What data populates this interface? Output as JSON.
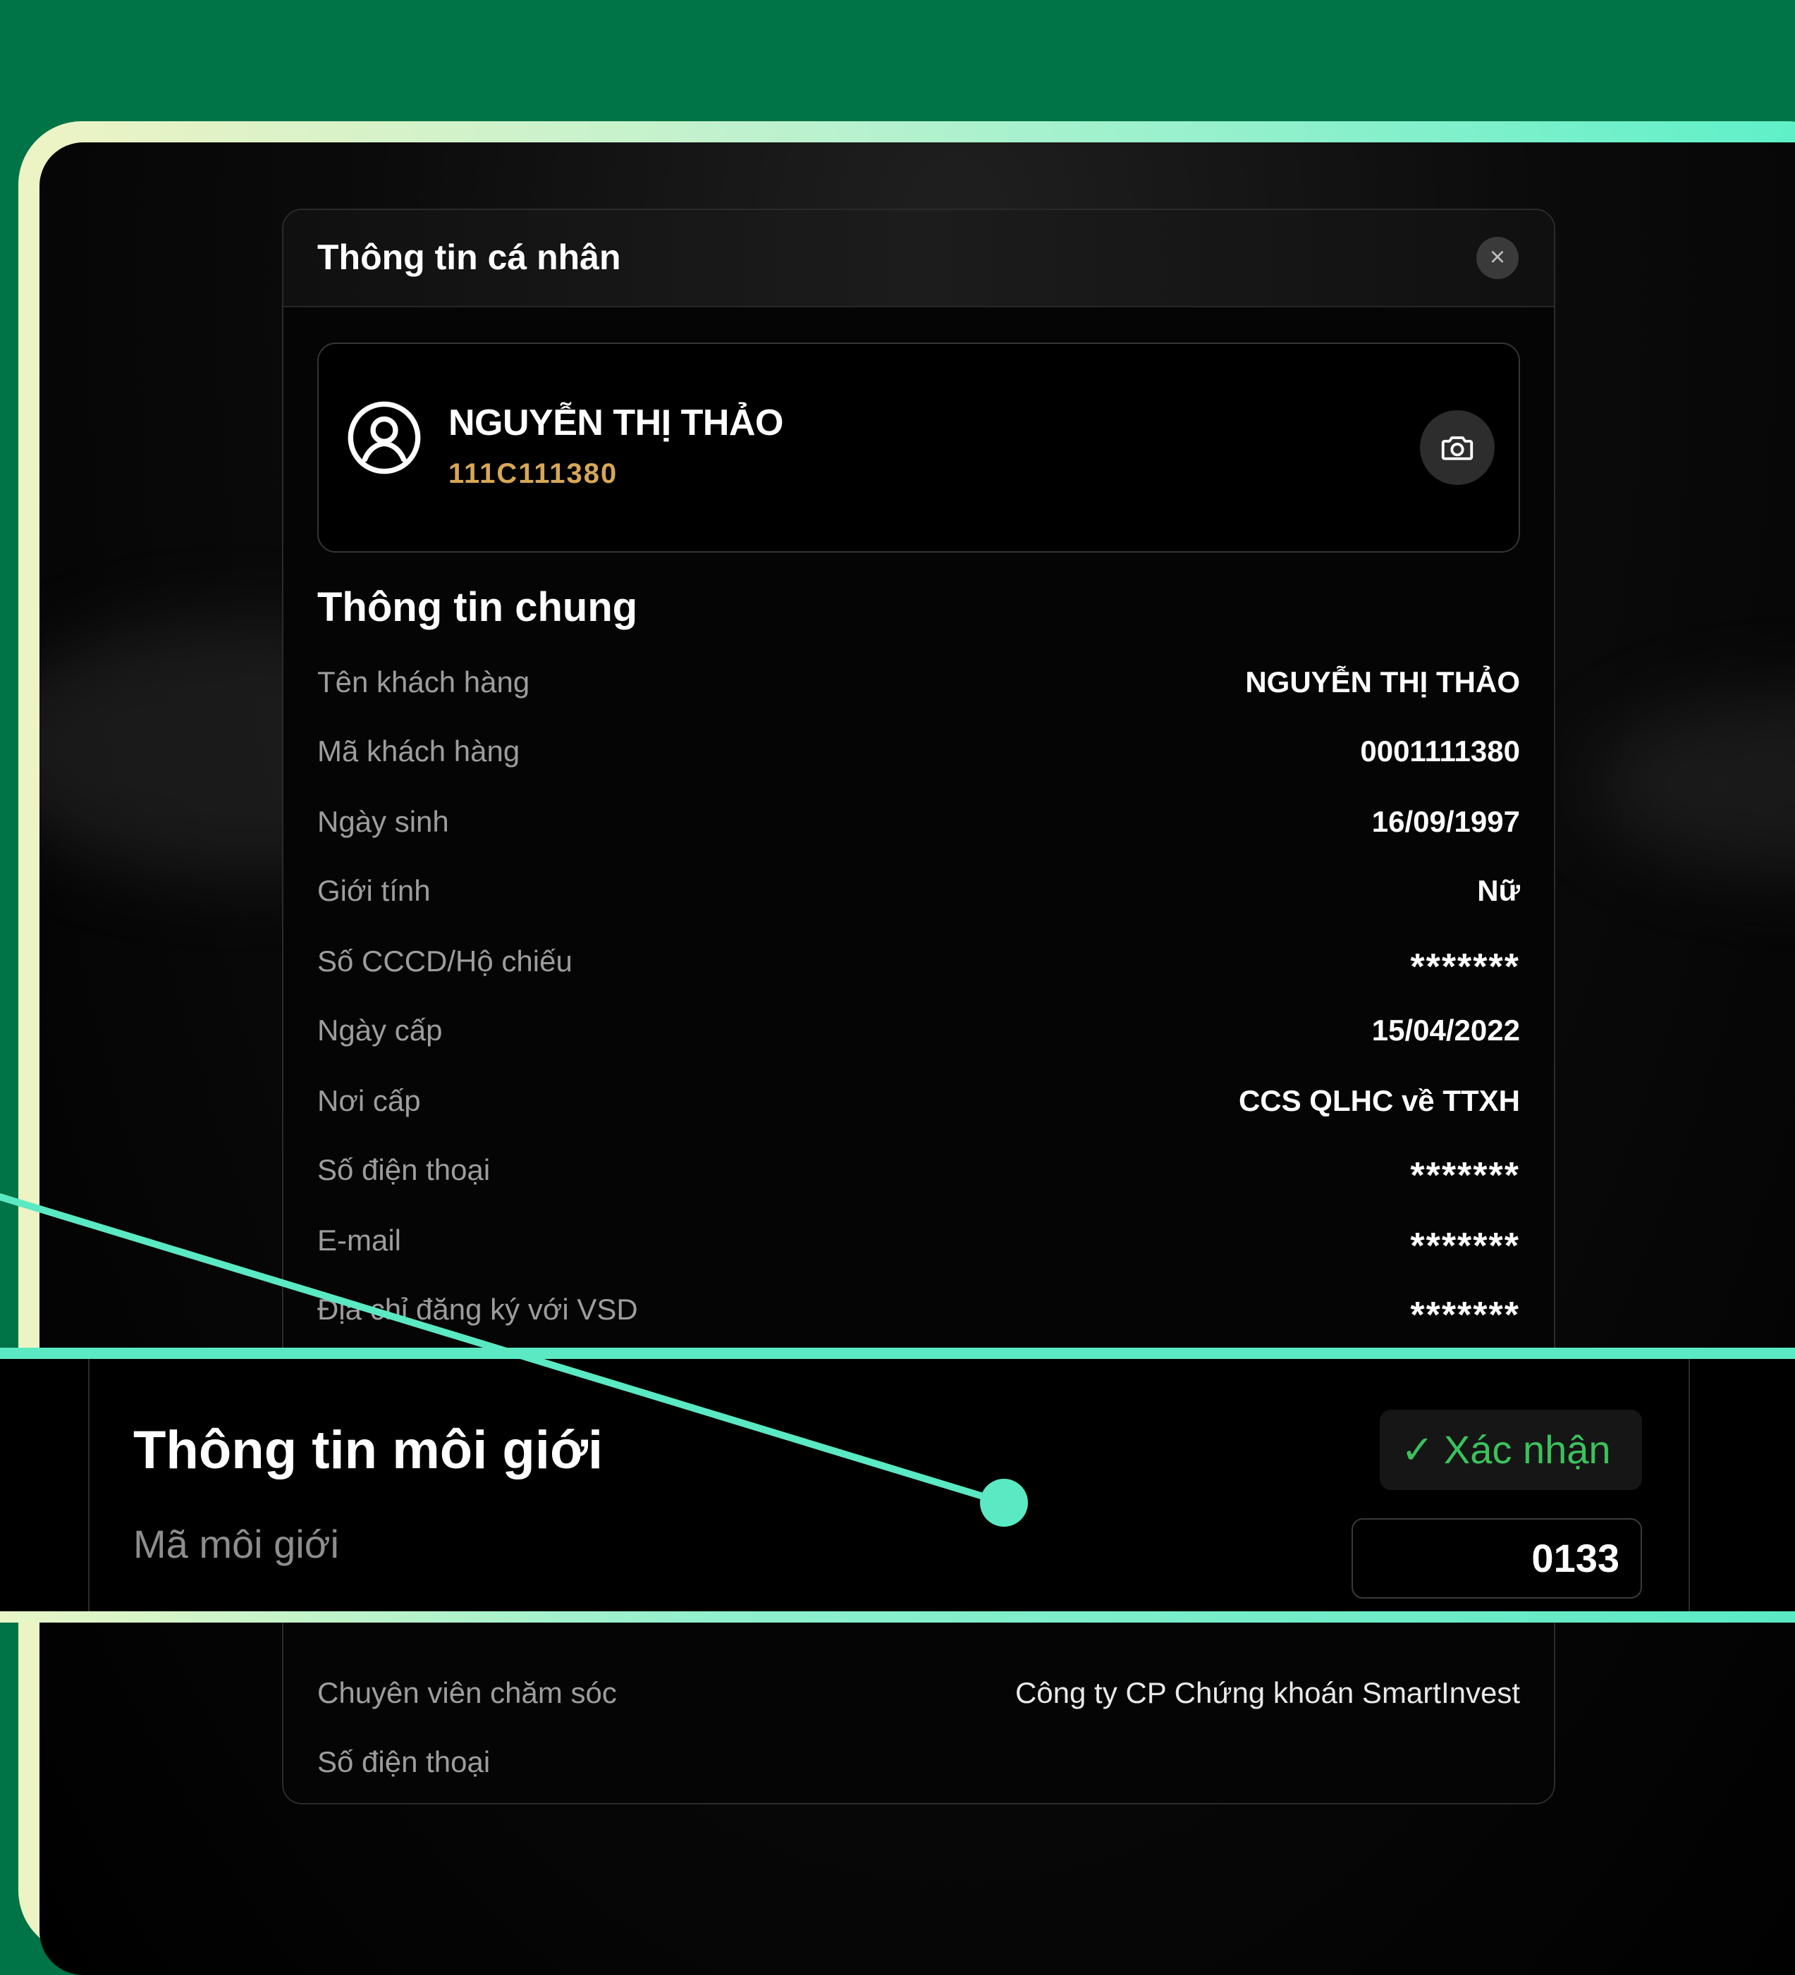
{
  "modal": {
    "title": "Thông tin cá nhân",
    "close_label": "×"
  },
  "profile": {
    "name": "NGUYỄN THỊ THẢO",
    "account_code": "111C111380"
  },
  "general": {
    "title": "Thông tin chung",
    "rows": [
      {
        "label": "Tên khách hàng",
        "value": "NGUYỄN THỊ THẢO"
      },
      {
        "label": "Mã khách hàng",
        "value": "0001111380"
      },
      {
        "label": "Ngày sinh",
        "value": "16/09/1997"
      },
      {
        "label": "Giới tính",
        "value": "Nữ"
      },
      {
        "label": "Số CCCD/Hộ chiếu",
        "value": "*******"
      },
      {
        "label": "Ngày cấp",
        "value": "15/04/2022"
      },
      {
        "label": "Nơi cấp",
        "value": "CCS QLHC về TTXH"
      },
      {
        "label": "Số điện thoại",
        "value": "*******"
      },
      {
        "label": "E-mail",
        "value": "*******"
      },
      {
        "label": "Địa chỉ đăng ký với VSD",
        "value": "*******"
      }
    ]
  },
  "broker": {
    "title": "Thông tin môi giới",
    "code_label": "Mã môi giới",
    "code_value": "0133",
    "confirm_label": "Xác nhận",
    "check_glyph": "✓"
  },
  "care": {
    "rows": [
      {
        "label": "Chuyên viên chăm sóc",
        "value": "Công ty CP Chứng khoán SmartInvest"
      },
      {
        "label": "Số điện thoại",
        "value": ""
      }
    ]
  },
  "colors": {
    "background": "#007347",
    "accent": "#5ae9c3",
    "account_code": "#d6a757",
    "confirm_text": "#3bc25c"
  }
}
